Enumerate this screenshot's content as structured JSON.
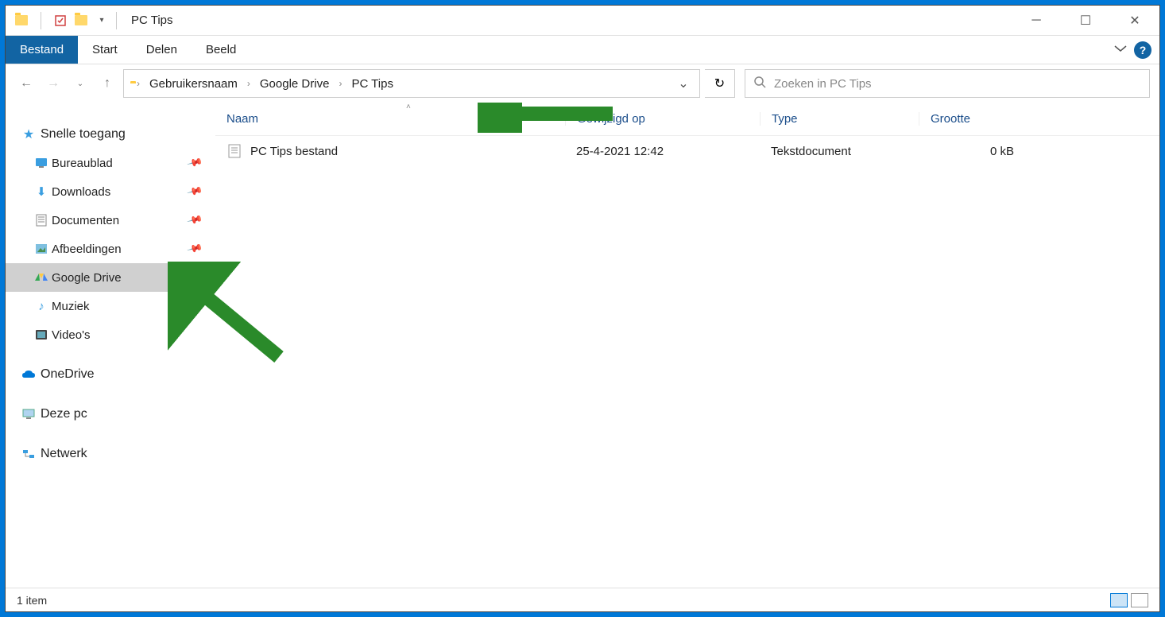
{
  "window": {
    "title": "PC Tips"
  },
  "menu": {
    "file": "Bestand",
    "items": [
      "Start",
      "Delen",
      "Beeld"
    ]
  },
  "breadcrumb": [
    "Gebruikersnaam",
    "Google Drive",
    "PC Tips"
  ],
  "search": {
    "placeholder": "Zoeken in PC Tips"
  },
  "sidebar": {
    "quick": "Snelle toegang",
    "items": [
      {
        "label": "Bureaublad",
        "pinned": true
      },
      {
        "label": "Downloads",
        "pinned": true
      },
      {
        "label": "Documenten",
        "pinned": true
      },
      {
        "label": "Afbeeldingen",
        "pinned": true
      },
      {
        "label": "Google Drive",
        "pinned": true,
        "selected": true
      },
      {
        "label": "Muziek",
        "pinned": false
      },
      {
        "label": "Video's",
        "pinned": false
      }
    ],
    "onedrive": "OneDrive",
    "thispc": "Deze pc",
    "network": "Netwerk"
  },
  "columns": {
    "name": "Naam",
    "modified": "Gewijzigd op",
    "type": "Type",
    "size": "Grootte"
  },
  "files": [
    {
      "name": "PC Tips bestand",
      "modified": "25-4-2021 12:42",
      "type": "Tekstdocument",
      "size": "0 kB"
    }
  ],
  "status": {
    "count": "1 item"
  }
}
